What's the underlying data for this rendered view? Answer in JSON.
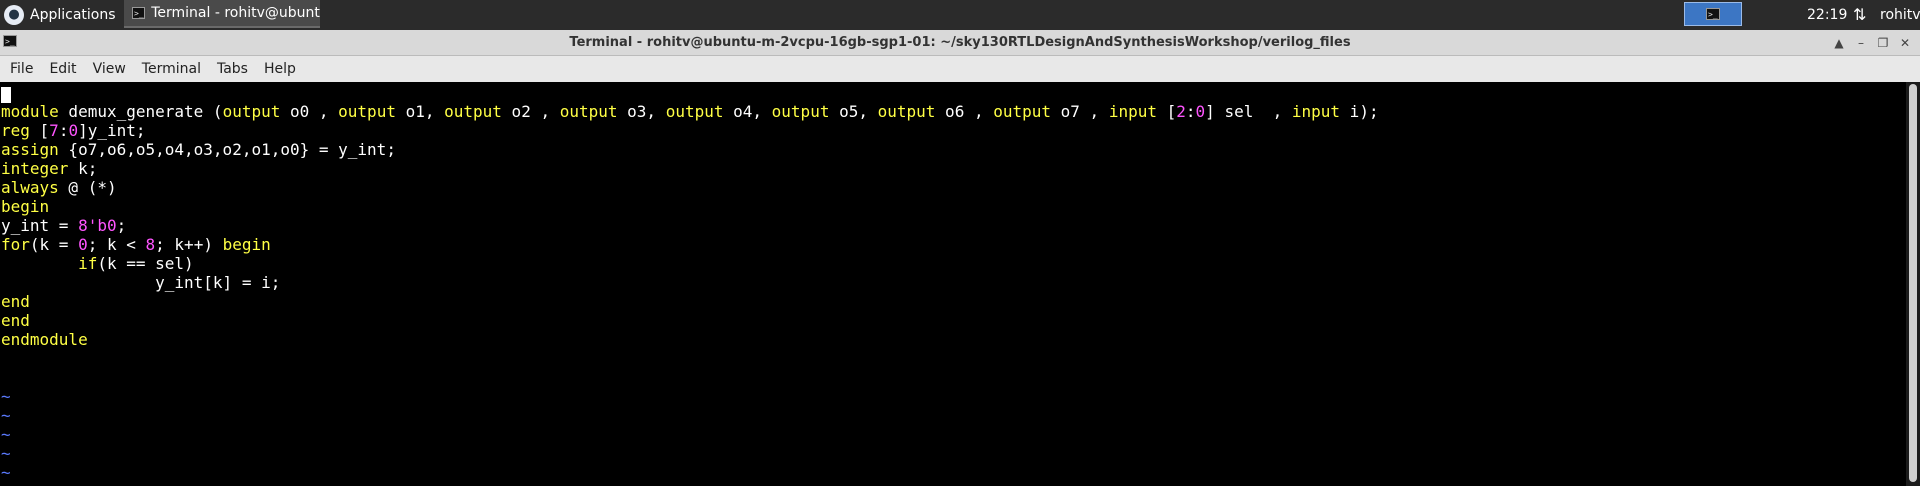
{
  "taskbar": {
    "applications_label": "Applications",
    "task_label": "Terminal - rohitv@ubunt...",
    "clock": "22:19",
    "user": "rohitv"
  },
  "window": {
    "title": "Terminal - rohitv@ubuntu-m-2vcpu-16gb-sgp1-01: ~/sky130RTLDesignAndSynthesisWorkshop/verilog_files"
  },
  "menu": [
    "File",
    "Edit",
    "View",
    "Terminal",
    "Tabs",
    "Help"
  ],
  "colors": {
    "keyword": "#ffff44",
    "number": "#ff55ff",
    "tilde": "#5b7bff",
    "text": "#ffffff",
    "background": "#000000"
  },
  "code": [
    [
      {
        "t": "module",
        "c": "k"
      },
      {
        "t": " demux_generate ("
      },
      {
        "t": "output",
        "c": "k"
      },
      {
        "t": " o0 , "
      },
      {
        "t": "output",
        "c": "k"
      },
      {
        "t": " o1, "
      },
      {
        "t": "output",
        "c": "k"
      },
      {
        "t": " o2 , "
      },
      {
        "t": "output",
        "c": "k"
      },
      {
        "t": " o3, "
      },
      {
        "t": "output",
        "c": "k"
      },
      {
        "t": " o4, "
      },
      {
        "t": "output",
        "c": "k"
      },
      {
        "t": " o5, "
      },
      {
        "t": "output",
        "c": "k"
      },
      {
        "t": " o6 , "
      },
      {
        "t": "output",
        "c": "k"
      },
      {
        "t": " o7 , "
      },
      {
        "t": "input",
        "c": "k"
      },
      {
        "t": " ["
      },
      {
        "t": "2",
        "c": "n"
      },
      {
        "t": ":"
      },
      {
        "t": "0",
        "c": "n"
      },
      {
        "t": "] sel  , "
      },
      {
        "t": "input",
        "c": "k"
      },
      {
        "t": " i);"
      }
    ],
    [
      {
        "t": "reg",
        "c": "k"
      },
      {
        "t": " ["
      },
      {
        "t": "7",
        "c": "n"
      },
      {
        "t": ":"
      },
      {
        "t": "0",
        "c": "n"
      },
      {
        "t": "]y_int;"
      }
    ],
    [
      {
        "t": "assign",
        "c": "k"
      },
      {
        "t": " {o7,o6,o5,o4,o3,o2,o1,o0} = y_int;"
      }
    ],
    [
      {
        "t": "integer",
        "c": "k"
      },
      {
        "t": " k;"
      }
    ],
    [
      {
        "t": "always",
        "c": "k"
      },
      {
        "t": " @ (*)"
      }
    ],
    [
      {
        "t": "begin",
        "c": "k"
      }
    ],
    [
      {
        "t": "y_int = "
      },
      {
        "t": "8'b0",
        "c": "n"
      },
      {
        "t": ";"
      }
    ],
    [
      {
        "t": "for",
        "c": "k"
      },
      {
        "t": "(k = "
      },
      {
        "t": "0",
        "c": "n"
      },
      {
        "t": "; k < "
      },
      {
        "t": "8",
        "c": "n"
      },
      {
        "t": "; k++) "
      },
      {
        "t": "begin",
        "c": "k"
      }
    ],
    [
      {
        "t": "        "
      },
      {
        "t": "if",
        "c": "k"
      },
      {
        "t": "(k == sel)"
      }
    ],
    [
      {
        "t": "                y_int[k] = i;"
      }
    ],
    [
      {
        "t": "end",
        "c": "k"
      }
    ],
    [
      {
        "t": "end",
        "c": "k"
      }
    ],
    [
      {
        "t": "endmodule",
        "c": "k"
      }
    ],
    [],
    [],
    [
      {
        "t": "~",
        "c": "t"
      }
    ],
    [
      {
        "t": "~",
        "c": "t"
      }
    ],
    [
      {
        "t": "~",
        "c": "t"
      }
    ],
    [
      {
        "t": "~",
        "c": "t"
      }
    ],
    [
      {
        "t": "~",
        "c": "t"
      }
    ]
  ]
}
